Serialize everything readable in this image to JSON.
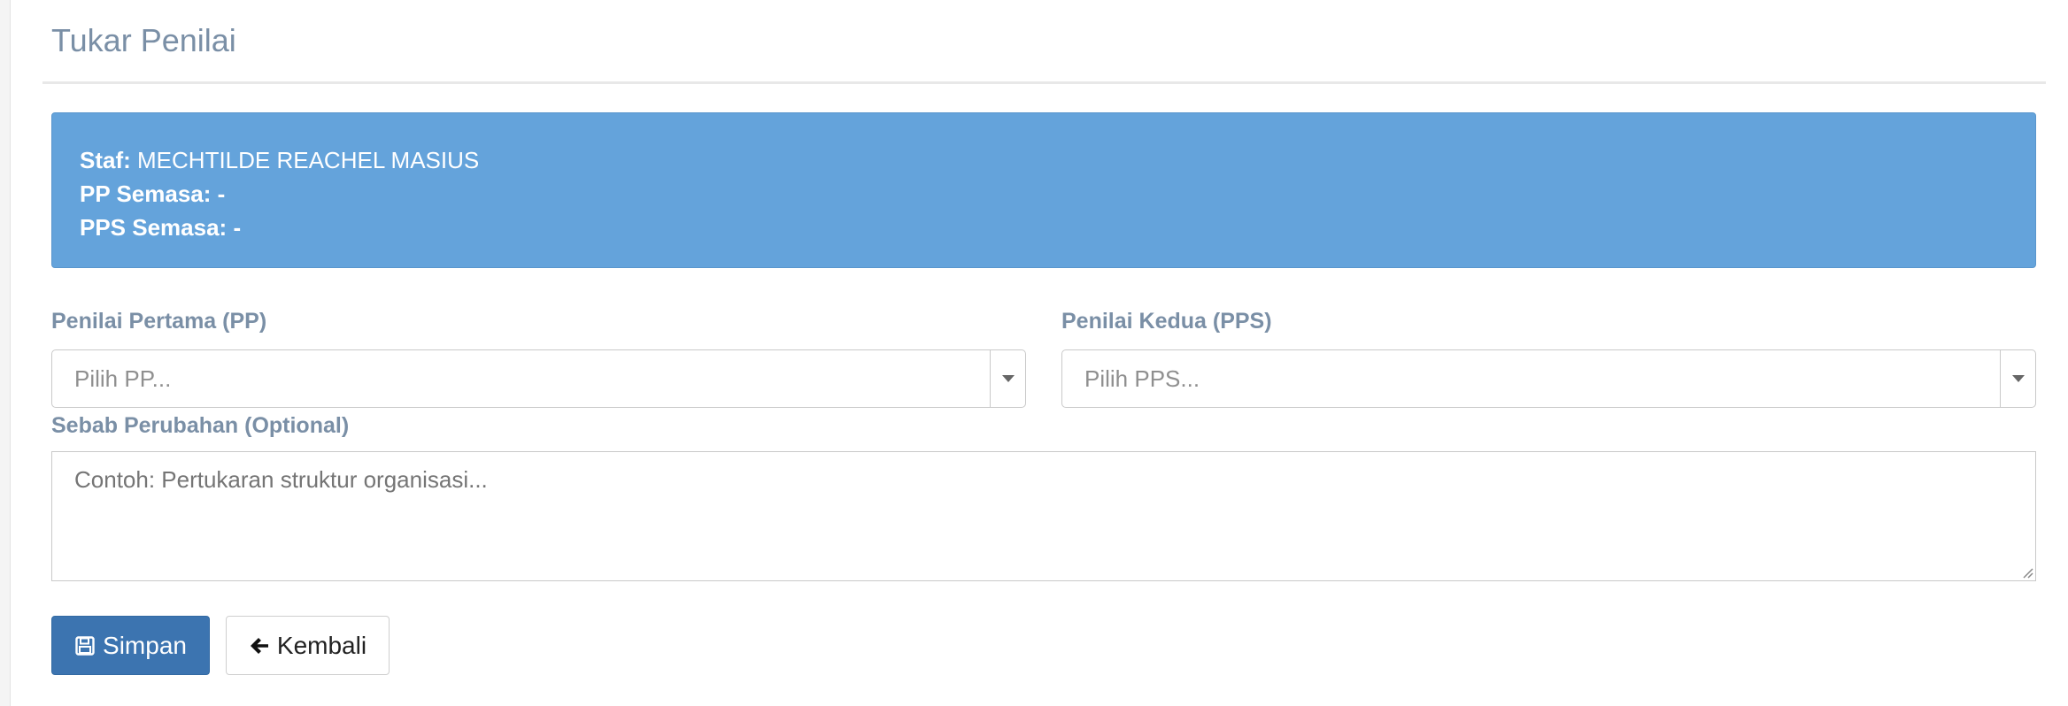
{
  "page": {
    "title": "Tukar Penilai"
  },
  "info": {
    "staf_label": "Staf:",
    "staf_value": "MECHTILDE REACHEL MASIUS",
    "pp_label": "PP Semasa:",
    "pp_value": "-",
    "pps_label": "PPS Semasa:",
    "pps_value": "-"
  },
  "form": {
    "pp_label": "Penilai Pertama (PP)",
    "pp_placeholder": "Pilih PP...",
    "pps_label": "Penilai Kedua (PPS)",
    "pps_placeholder": "Pilih PPS...",
    "reason_label": "Sebab Perubahan (Optional)",
    "reason_placeholder": "Contoh: Pertukaran struktur organisasi..."
  },
  "actions": {
    "save_label": "Simpan",
    "back_label": "Kembali"
  },
  "colors": {
    "info_bg": "#64a3db",
    "primary_button": "#3c74b0",
    "label_text": "#7a8fa6"
  },
  "icons": {
    "save": "floppy-disk-icon",
    "back": "arrow-left-icon",
    "dropdown": "caret-down-icon"
  }
}
